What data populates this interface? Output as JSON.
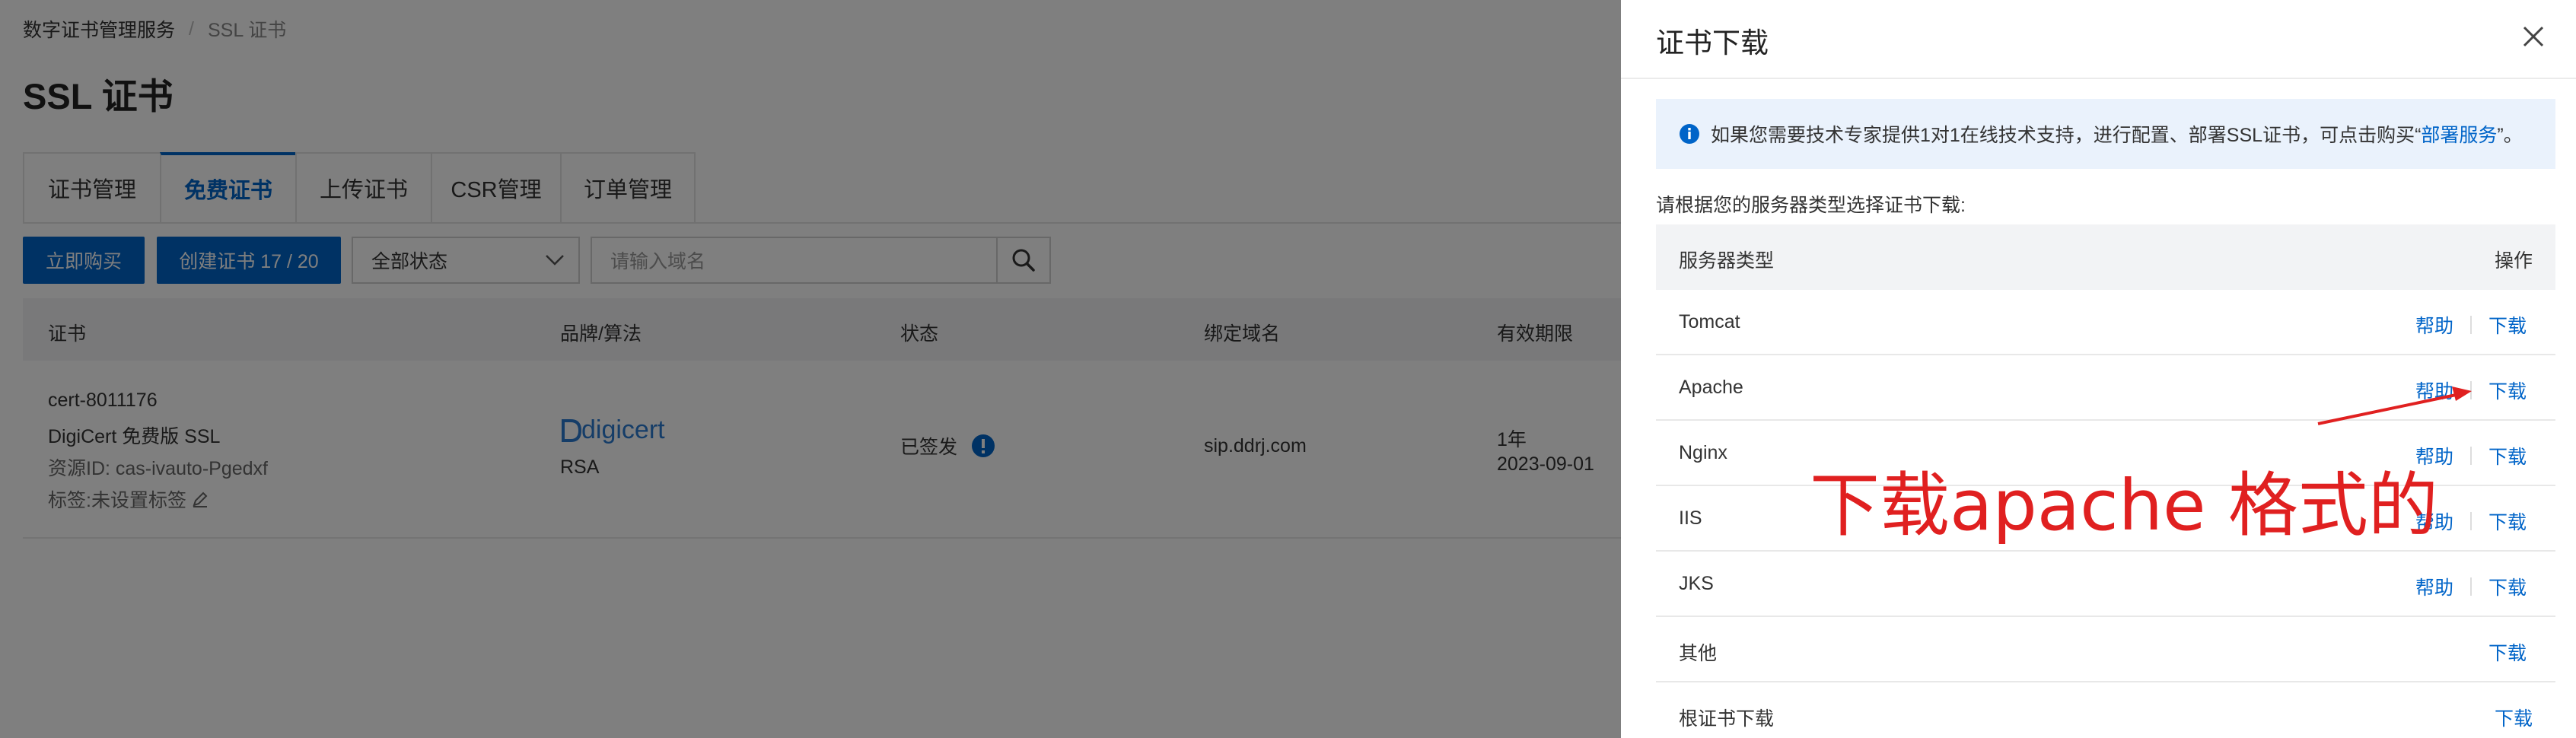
{
  "breadcrumb": {
    "parent": "数字证书管理服务",
    "separator": "/",
    "current": "SSL 证书"
  },
  "page_title": "SSL 证书",
  "tabs": [
    {
      "label": "证书管理",
      "active": false
    },
    {
      "label": "免费证书",
      "active": true
    },
    {
      "label": "上传证书",
      "active": false
    },
    {
      "label": "CSR管理",
      "active": false
    },
    {
      "label": "订单管理",
      "active": false
    }
  ],
  "toolbar": {
    "buy_label": "立即购买",
    "create_label": "创建证书 17 / 20",
    "status_select": "全部状态",
    "search_placeholder": "请输入域名"
  },
  "table": {
    "headers": [
      "证书",
      "品牌/算法",
      "状态",
      "绑定域名",
      "有效期限"
    ],
    "row": {
      "cert_id": "cert-8011176",
      "cert_name": "DigiCert 免费版 SSL",
      "resource_id": "资源ID: cas-ivauto-Pgedxf",
      "tags": "标签:未设置标签",
      "brand": "digicert",
      "algorithm": "RSA",
      "status": "已签发",
      "domain": "sip.ddrj.com",
      "validity": "1年",
      "expiry": "2023-09-01"
    }
  },
  "drawer": {
    "title": "证书下载",
    "notice_prefix": "如果您需要技术专家提供1对1在线技术支持，进行配置、部署SSL证书，可点击购买“",
    "notice_link": "部署服务",
    "notice_suffix": "”。",
    "instruction": "请根据您的服务器类型选择证书下载:",
    "col_server": "服务器类型",
    "col_ops": "操作",
    "help_label": "帮助",
    "download_label": "下载",
    "rows": [
      {
        "name": "Tomcat",
        "help": true
      },
      {
        "name": "Apache",
        "help": true
      },
      {
        "name": "Nginx",
        "help": true
      },
      {
        "name": "IIS",
        "help": true
      },
      {
        "name": "JKS",
        "help": true
      },
      {
        "name": "其他",
        "help": false
      },
      {
        "name": "根证书下载",
        "help": false
      }
    ]
  },
  "annotation": "下载apache 格式的",
  "colors": {
    "primary": "#0064c8",
    "annotation": "#e02020",
    "notice_bg": "#eaf2fc"
  }
}
